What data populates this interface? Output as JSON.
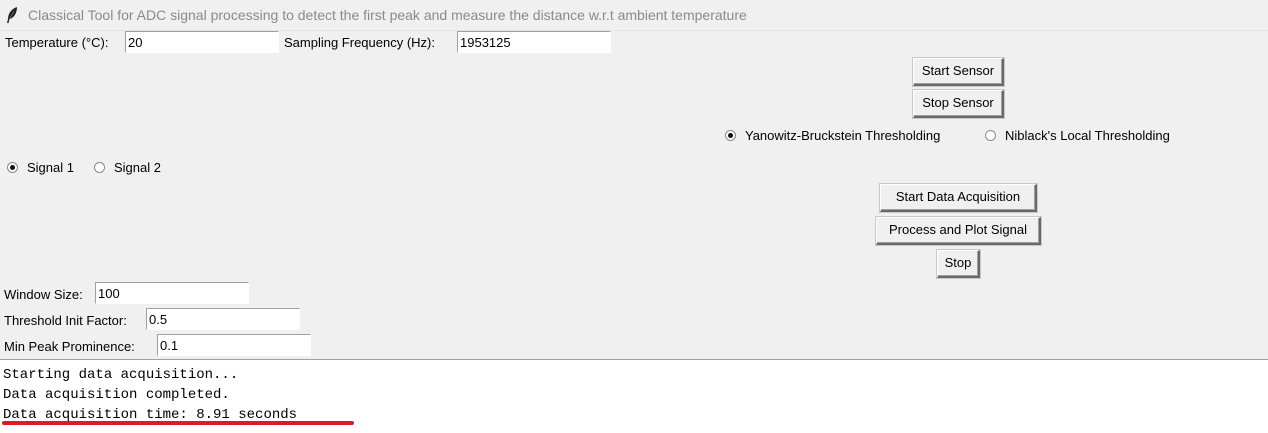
{
  "window": {
    "title": "Classical Tool for ADC signal processing to detect the first peak and measure the distance w.r.t ambient temperature",
    "icon": "feather-icon"
  },
  "params": {
    "temperature_label": "Temperature (°C):",
    "temperature_value": "20",
    "sampling_label": "Sampling Frequency (Hz):",
    "sampling_value": "1953125",
    "window_size_label": "Window Size:",
    "window_size_value": "100",
    "threshold_label": "Threshold Init Factor:",
    "threshold_value": "0.5",
    "prominence_label": "Min Peak Prominence:",
    "prominence_value": "0.1"
  },
  "buttons": {
    "start_sensor": "Start Sensor",
    "stop_sensor": "Stop Sensor",
    "start_acq": "Start Data Acquisition",
    "process_plot": "Process and Plot Signal",
    "stop": "Stop"
  },
  "thresholding": {
    "option1": "Yanowitz-Bruckstein Thresholding",
    "option2": "Niblack's Local Thresholding",
    "selected": "option1"
  },
  "signal": {
    "option1": "Signal 1",
    "option2": "Signal 2",
    "selected": "option1"
  },
  "console": {
    "lines": [
      "Starting data acquisition...",
      "Data acquisition completed.",
      "Data acquisition time: 8.91 seconds"
    ]
  },
  "colors": {
    "annotation_underline": "#e0192a"
  }
}
